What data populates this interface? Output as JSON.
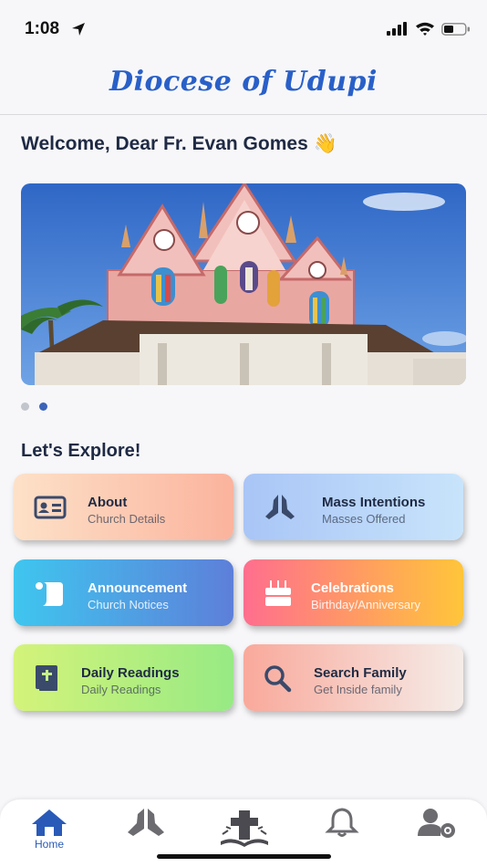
{
  "status": {
    "time": "1:08"
  },
  "header": {
    "title": "Diocese of Udupi"
  },
  "welcome": {
    "text": "Welcome, Dear Fr. Evan Gomes 👋"
  },
  "carousel": {
    "active_index": 1,
    "count": 2
  },
  "explore": {
    "heading": "Let's Explore!"
  },
  "cards": [
    {
      "title": "About",
      "subtitle": "Church Details",
      "icon": "id-card-icon"
    },
    {
      "title": "Mass Intentions",
      "subtitle": "Masses Offered",
      "icon": "praying-hands-icon"
    },
    {
      "title": "Announcement",
      "subtitle": "Church Notices",
      "icon": "scroll-icon"
    },
    {
      "title": "Celebrations",
      "subtitle": "Birthday/Anniversary",
      "icon": "cake-icon"
    },
    {
      "title": "Daily Readings",
      "subtitle": "Daily Readings",
      "icon": "bible-icon"
    },
    {
      "title": "Search Family",
      "subtitle": "Get Inside family",
      "icon": "search-icon"
    }
  ],
  "nav": {
    "home_label": "Home",
    "items": [
      "home-icon",
      "praying-hands-icon",
      "cross-book-icon",
      "bell-icon",
      "user-settings-icon"
    ]
  },
  "colors": {
    "accent": "#2960c8",
    "text": "#1f2a44",
    "icon": "#3a4a6b"
  }
}
